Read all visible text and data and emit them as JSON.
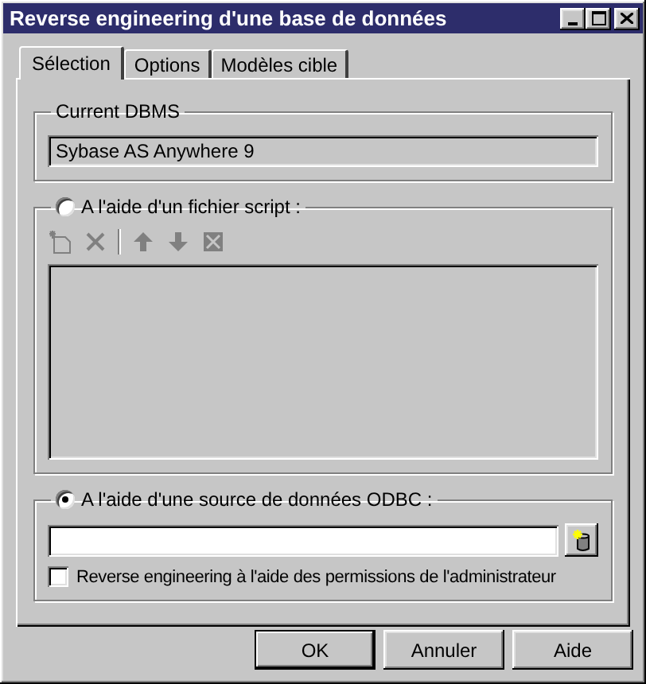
{
  "window": {
    "title": "Reverse engineering d'une base de données"
  },
  "tabs": [
    {
      "label": "Sélection",
      "selected": true
    },
    {
      "label": "Options",
      "selected": false
    },
    {
      "label": "Modèles cible",
      "selected": false
    }
  ],
  "current_dbms": {
    "label": "Current DBMS",
    "value": "Sybase AS Anywhere 9"
  },
  "sources": [
    {
      "kind": "script",
      "label": "A l'aide d'un fichier script :",
      "selected": false,
      "toolbar_disabled": true
    },
    {
      "kind": "odbc",
      "label": "A l'aide d'une source de données ODBC :",
      "selected": true,
      "admin_permissions": {
        "label": "Reverse engineering à l'aide des permissions de l'administrateur",
        "checked": false
      }
    }
  ],
  "buttons": [
    {
      "label": "OK",
      "default": true
    },
    {
      "label": "Annuler",
      "default": false
    },
    {
      "label": "Aide",
      "default": false
    }
  ]
}
